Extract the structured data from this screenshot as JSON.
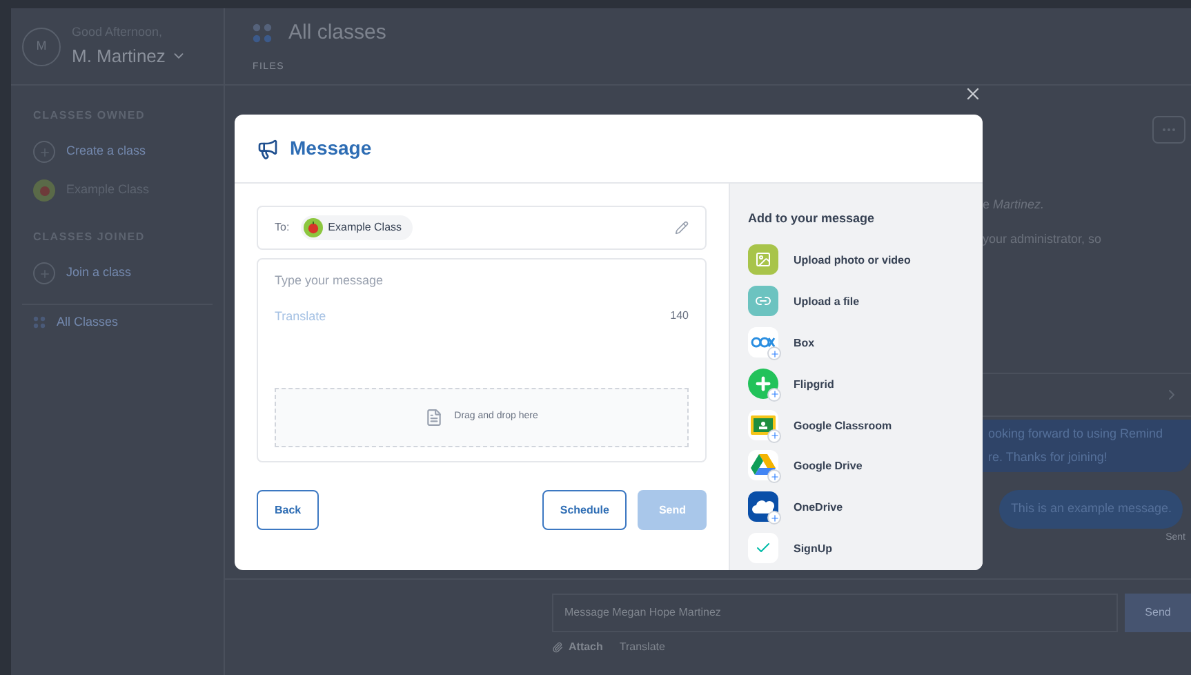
{
  "sidebar": {
    "avatar": "M",
    "greeting": "Good Afternoon,",
    "user": "M. Martinez",
    "sections": [
      {
        "heading": "CLASSES OWNED",
        "items": [
          {
            "kind": "add",
            "label": "Create a class"
          },
          {
            "kind": "class",
            "label": "Example Class"
          }
        ]
      },
      {
        "heading": "CLASSES JOINED",
        "items": [
          {
            "kind": "add",
            "label": "Join a class"
          }
        ]
      }
    ],
    "footer_item": "All Classes"
  },
  "header": {
    "title": "All classes",
    "tab": "FILES"
  },
  "conversation": {
    "intro": [
      "e *Martinez.*",
      "your administrator, so"
    ],
    "messages": [
      {
        "kind": "received",
        "lines": [
          "ooking forward to using Remind",
          "re. Thanks for joining!"
        ]
      },
      {
        "kind": "sent",
        "lines": [
          "This is an example message."
        ]
      }
    ],
    "sent_status": "Sent",
    "composer": {
      "placeholder": "Message Megan Hope Martinez",
      "send": "Send",
      "actions": [
        "Attach",
        "Translate"
      ]
    }
  },
  "dialog": {
    "title": "Message",
    "to_label": "To:",
    "recipient": "Example Class",
    "placeholder": "Type your message",
    "link": "Translate",
    "counter": "140",
    "drop_hint": "Drag and drop here",
    "buttons": [
      {
        "label": "Back",
        "kind": "outline",
        "disabled": false
      },
      {
        "label": "Schedule",
        "kind": "outline",
        "disabled": false
      },
      {
        "label": "Send",
        "kind": "primary",
        "disabled": true
      }
    ],
    "add_heading": "Add to your message",
    "add_items": [
      {
        "kind": "photo",
        "label": "Upload photo or video"
      },
      {
        "kind": "file",
        "label": "Upload a file"
      },
      {
        "kind": "box",
        "label": "Box"
      },
      {
        "kind": "flipgrid",
        "label": "Flipgrid"
      },
      {
        "kind": "classroom",
        "label": "Google Classroom"
      },
      {
        "kind": "drive",
        "label": "Google Drive"
      },
      {
        "kind": "onedrive",
        "label": "OneDrive"
      },
      {
        "kind": "signup",
        "label": "SignUp"
      }
    ]
  }
}
